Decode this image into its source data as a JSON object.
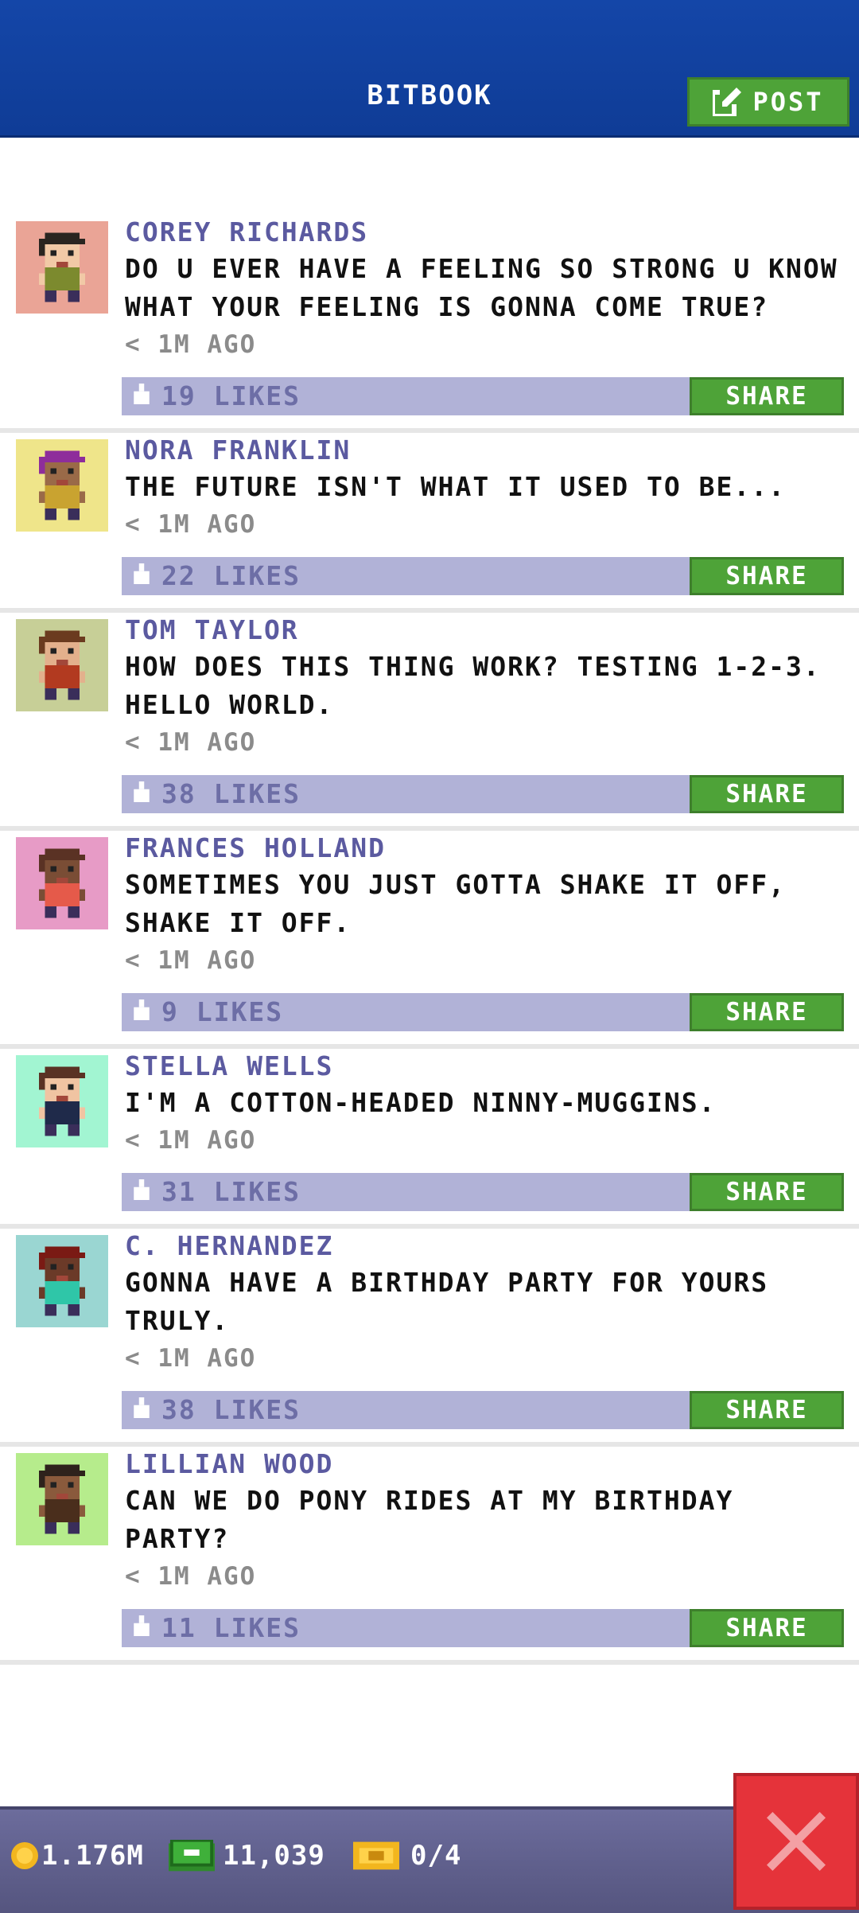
{
  "header": {
    "title": "BITBOOK",
    "post_label": "POST"
  },
  "posts": [
    {
      "author": "COREY RICHARDS",
      "message": "DO U EVER HAVE A FEELING SO STRONG U KNOW WHAT YOUR FEELING IS GONNA COME TRUE?",
      "time": "< 1M AGO",
      "likes": "19 LIKES",
      "share": "SHARE",
      "avatar_bg": "#eaa496",
      "skin": "#f1c9a6",
      "hair": "#2a2520",
      "shirt": "#7c8a2e"
    },
    {
      "author": "NORA FRANKLIN",
      "message": "THE FUTURE ISN'T WHAT IT USED TO BE...",
      "time": "< 1M AGO",
      "likes": "22 LIKES",
      "share": "SHARE",
      "avatar_bg": "#efe58a",
      "skin": "#9a6a48",
      "hair": "#8e2d9b",
      "shirt": "#c9a330"
    },
    {
      "author": "TOM TAYLOR",
      "message": "HOW DOES THIS THING WORK? TESTING 1-2-3. HELLO WORLD.",
      "time": "< 1M AGO",
      "likes": "38 LIKES",
      "share": "SHARE",
      "avatar_bg": "#c7cf97",
      "skin": "#e3b08c",
      "hair": "#6b3b1f",
      "shirt": "#b23a20"
    },
    {
      "author": "FRANCES HOLLAND",
      "message": "SOMETIMES YOU JUST GOTTA SHAKE IT OFF, SHAKE IT OFF.",
      "time": "< 1M AGO",
      "likes": "9 LIKES",
      "share": "SHARE",
      "avatar_bg": "#e79bc6",
      "skin": "#7a4d35",
      "hair": "#5a3224",
      "shirt": "#e55a4a"
    },
    {
      "author": "STELLA WELLS",
      "message": "I'M A COTTON-HEADED NINNY-MUGGINS.",
      "time": "< 1M AGO",
      "likes": "31 LIKES",
      "share": "SHARE",
      "avatar_bg": "#a2f5d2",
      "skin": "#f0c4a2",
      "hair": "#5a3224",
      "shirt": "#1f2a4a"
    },
    {
      "author": "C. HERNANDEZ",
      "message": "GONNA HAVE A BIRTHDAY PARTY FOR YOURS TRULY.",
      "time": "< 1M AGO",
      "likes": "38 LIKES",
      "share": "SHARE",
      "avatar_bg": "#9ad6d2",
      "skin": "#6b3a28",
      "hair": "#7a1a14",
      "shirt": "#2fc6a8"
    },
    {
      "author": "LILLIAN WOOD",
      "message": "CAN WE DO PONY RIDES AT MY BIRTHDAY PARTY?",
      "time": "< 1M AGO",
      "likes": "11 LIKES",
      "share": "SHARE",
      "avatar_bg": "#b6ec8c",
      "skin": "#8a5a3c",
      "hair": "#2e221c",
      "shirt": "#4a2e1c"
    }
  ],
  "bottom_bar": {
    "coins": "1.176M",
    "bux": "11,039",
    "tickets": "0/4",
    "coin_icon": "coin-icon",
    "bux_icon": "cash-icon",
    "ticket_icon": "ticket-icon"
  },
  "colors": {
    "accent_green": "#4ea338",
    "header_blue": "#1446a8",
    "name_purple": "#5b5aa0",
    "like_bar": "#b1b2d7",
    "close_red": "#e5333a"
  }
}
